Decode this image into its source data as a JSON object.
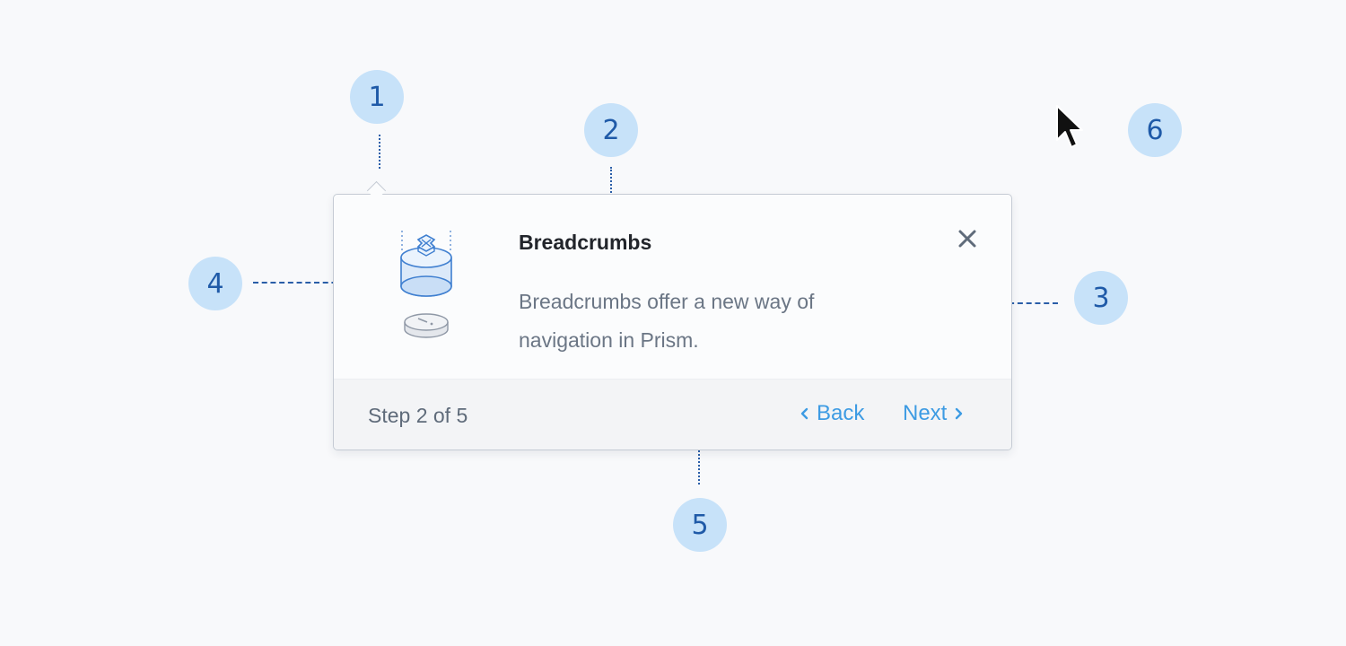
{
  "markers": [
    "1",
    "2",
    "3",
    "4",
    "5",
    "6"
  ],
  "tooltip": {
    "title": "Breadcrumbs",
    "body": "Breadcrumbs offer a new way of navigation in Prism.",
    "step": "Step 2 of 5",
    "back_label": "Back",
    "next_label": "Next"
  },
  "icons": {
    "close": "close-icon",
    "back": "chevron-left-icon",
    "next": "chevron-right-icon",
    "illustration": "prism-cylinder-illustration",
    "pointer": "mouse-pointer-icon"
  },
  "colors": {
    "marker_bg": "#c7e2f9",
    "marker_text": "#1f5aa8",
    "link": "#3d9be3",
    "title": "#22252b",
    "body": "#6b7685"
  }
}
